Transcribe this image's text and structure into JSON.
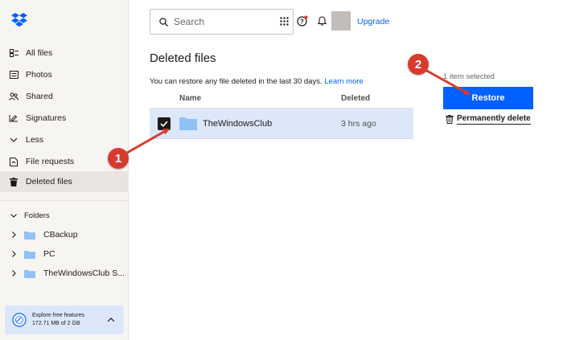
{
  "sidebar": {
    "items": [
      {
        "label": "All files",
        "icon": "all-files-icon"
      },
      {
        "label": "Photos",
        "icon": "photos-icon"
      },
      {
        "label": "Shared",
        "icon": "shared-icon"
      },
      {
        "label": "Signatures",
        "icon": "signatures-icon"
      },
      {
        "label": "Less",
        "icon": "chevron-down-icon"
      },
      {
        "label": "File requests",
        "icon": "file-requests-icon"
      },
      {
        "label": "Deleted files",
        "icon": "trash-icon",
        "active": true
      }
    ],
    "folders_label": "Folders",
    "folders": [
      {
        "label": "CBackup"
      },
      {
        "label": "PC"
      },
      {
        "label": "TheWindowsClub S..."
      }
    ],
    "promo": {
      "line1": "Explore free features",
      "line2": "172.71 MB of 2 GB"
    }
  },
  "topbar": {
    "search_placeholder": "Search",
    "upgrade_label": "Upgrade"
  },
  "main": {
    "title": "Deleted files",
    "info_text": "You can restore any file deleted in the last 30 days.",
    "learn_more": "Learn more",
    "columns": {
      "name": "Name",
      "deleted": "Deleted"
    },
    "rows": [
      {
        "name": "TheWindowsClub",
        "deleted": "3 hrs ago",
        "selected": true
      }
    ]
  },
  "panel": {
    "selected_text": "1 item selected",
    "restore_label": "Restore",
    "permanently_delete_label": "Permanently delete"
  },
  "annotations": {
    "badge1": "1",
    "badge2": "2"
  },
  "colors": {
    "accent": "#0061fe",
    "selection": "#dce8fa",
    "annotation": "#d93a2e",
    "folder": "#90c0f5"
  }
}
